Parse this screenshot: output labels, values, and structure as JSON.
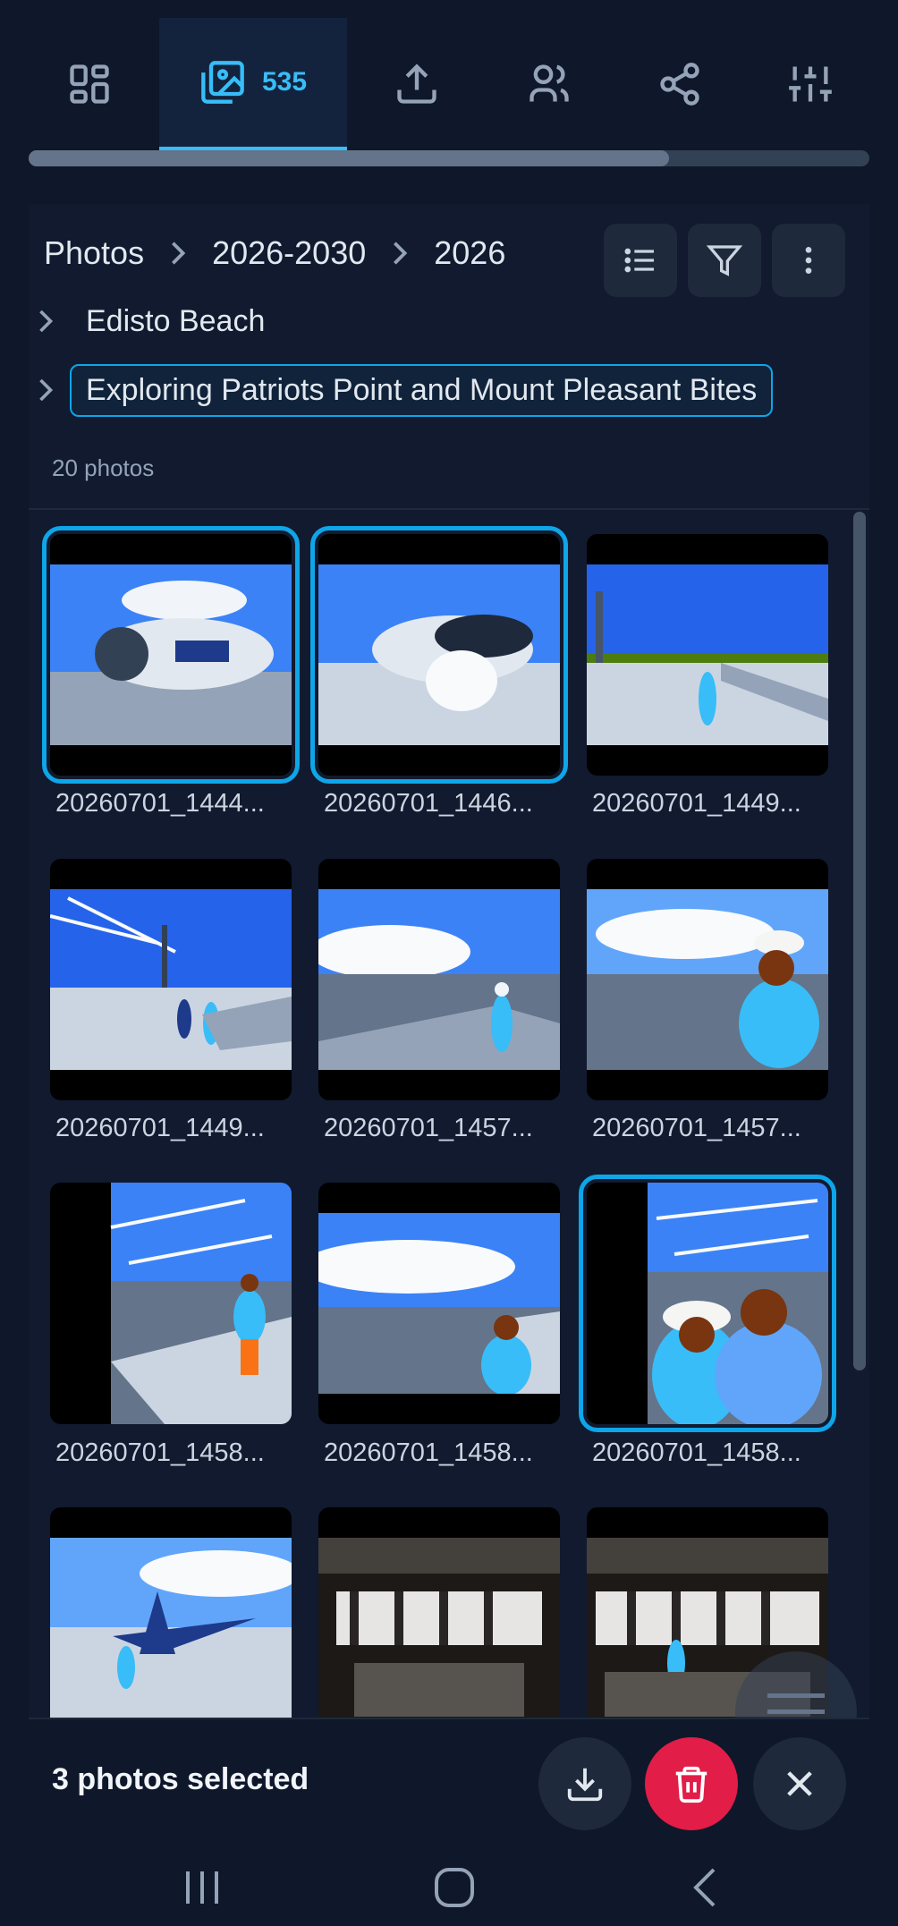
{
  "nav": {
    "tabs": [
      {
        "icon": "grid-icon"
      },
      {
        "icon": "photos-icon",
        "count": "535",
        "active": true
      },
      {
        "icon": "upload-icon"
      },
      {
        "icon": "people-icon"
      },
      {
        "icon": "share-icon"
      },
      {
        "icon": "sliders-icon"
      }
    ],
    "accent": "#38bdf8"
  },
  "breadcrumb": {
    "items": [
      "Photos",
      "2026-2030",
      "2026"
    ]
  },
  "albums": [
    {
      "name": "Edisto Beach"
    },
    {
      "name": "Exploring Patriots Point and Mount Pleasant Bites",
      "selected": true
    }
  ],
  "album_count": "20 photos",
  "photos": [
    {
      "caption": "20260701_1444...",
      "selected": true
    },
    {
      "caption": "20260701_1446...",
      "selected": true
    },
    {
      "caption": "20260701_1449..."
    },
    {
      "caption": "20260701_1449..."
    },
    {
      "caption": "20260701_1457..."
    },
    {
      "caption": "20260701_1457..."
    },
    {
      "caption": "20260701_1458..."
    },
    {
      "caption": "20260701_1458..."
    },
    {
      "caption": "20260701_1458...",
      "selected": true
    },
    {
      "caption": ""
    },
    {
      "caption": ""
    },
    {
      "caption": ""
    }
  ],
  "selection": {
    "text": "3 photos selected",
    "delete_color": "#e11d48"
  }
}
